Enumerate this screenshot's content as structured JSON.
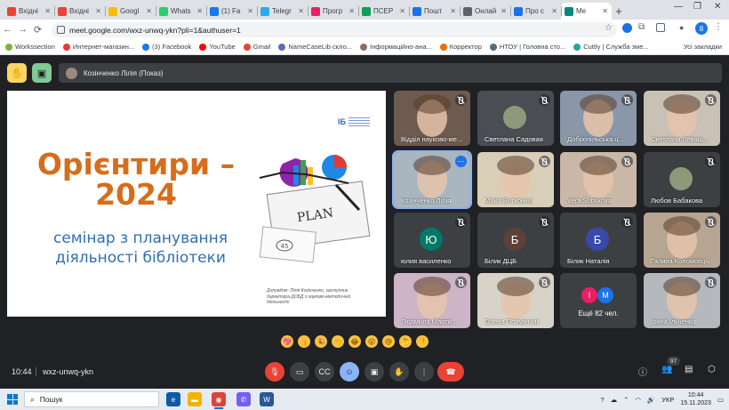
{
  "browser": {
    "tabs": [
      {
        "label": "Вхідні",
        "color": "#ea4335"
      },
      {
        "label": "Вхідні",
        "color": "#ea4335"
      },
      {
        "label": "Googl",
        "color": "#fbbc04"
      },
      {
        "label": "Whats",
        "color": "#25d366"
      },
      {
        "label": "(1) Fa",
        "color": "#1877f2"
      },
      {
        "label": "Telegr",
        "color": "#2aabee"
      },
      {
        "label": "Прогр",
        "color": "#e91e63"
      },
      {
        "label": "ПСЕР",
        "color": "#0f9d58"
      },
      {
        "label": "Пошт",
        "color": "#1a73e8"
      },
      {
        "label": "Онлай",
        "color": "#5f6368"
      },
      {
        "label": "Про с",
        "color": "#1a73e8"
      },
      {
        "label": "Me",
        "color": "#00897b",
        "active": true
      }
    ],
    "url": "meet.google.com/wxz-unwq-ykn?pli=1&authuser=1",
    "bookmarks": [
      {
        "label": "Workssection",
        "color": "#7cb342"
      },
      {
        "label": "Интернет-магазин...",
        "color": "#e53935"
      },
      {
        "label": "(3) Facebook",
        "color": "#1877f2"
      },
      {
        "label": "YouTube",
        "color": "#ff0000"
      },
      {
        "label": "Gmail",
        "color": "#ea4335"
      },
      {
        "label": "NameCaseLib скло...",
        "color": "#5c6bc0"
      },
      {
        "label": "Інформаційно-ана...",
        "color": "#8d6e63"
      },
      {
        "label": "Корректор",
        "color": "#ef6c00"
      },
      {
        "label": "НТОУ | Головна сто...",
        "color": "#546e7a"
      },
      {
        "label": "Cuttly | Служба зме...",
        "color": "#26a69a"
      }
    ],
    "all_bookmarks": "Усі закладки"
  },
  "meet": {
    "presenter_label": "Козінченко Лілія (Показ)",
    "slide": {
      "title_line1": "Орієнтири –",
      "title_line2": "2024",
      "subtitle_line1": "семінар з планування",
      "subtitle_line2": "діяльності бібліотеки",
      "footer": "Доповідач: Лілія Козінченко, заступник директора ДОБД з науково-методичної діяльності",
      "plan_label": "PLAN"
    },
    "participants": [
      {
        "name": "Відділ науково-ме...",
        "bg": "#6d5b4f",
        "type": "video"
      },
      {
        "name": "Светлана Садовая",
        "bg": "#4a4d52",
        "type": "photo"
      },
      {
        "name": "Добропільська ц...",
        "bg": "#8a97a8",
        "type": "video"
      },
      {
        "name": "Светлана Леваш...",
        "bg": "#c9c1b5",
        "type": "video"
      },
      {
        "name": "Козінченко Лілія",
        "bg": "#a9b5bf",
        "type": "video",
        "selected": true
      },
      {
        "name": "Майя Витконіна",
        "bg": "#d9cfb8",
        "type": "video"
      },
      {
        "name": "Vera Soblikova",
        "bg": "#c9b8a8",
        "type": "video"
      },
      {
        "name": "Любов Бабакова",
        "bg": "#3c4043",
        "type": "photo"
      },
      {
        "name": "юлия василенко",
        "bg": "#3c4043",
        "type": "avatar",
        "letter": "Ю",
        "avatar_color": "#00796b"
      },
      {
        "name": "Білик ДЦБ",
        "bg": "#3c4043",
        "type": "avatar",
        "letter": "Б",
        "avatar_color": "#5d4037"
      },
      {
        "name": "Білик Наталія",
        "bg": "#3c4043",
        "type": "avatar",
        "letter": "Б",
        "avatar_color": "#3949ab"
      },
      {
        "name": "Галина Коломоєць",
        "bg": "#b7a593",
        "type": "video"
      },
      {
        "name": "Людмила Марти...",
        "bg": "#cdb4c6",
        "type": "video"
      },
      {
        "name": "Олена Полуянчик",
        "bg": "#d8d3c8",
        "type": "video"
      },
      {
        "name": "Ещё 82 чел.",
        "bg": "#3c4043",
        "type": "more",
        "letters": [
          "І",
          "М"
        ]
      },
      {
        "name": "Ірина Ільченко",
        "bg": "#b5b9be",
        "type": "video"
      }
    ],
    "reactions": [
      "💖",
      "👍",
      "🎉",
      "👏",
      "😂",
      "😮",
      "😢",
      "🤔",
      "👎"
    ],
    "time": "10:44",
    "meeting_code": "wxz-unwq-ykn",
    "people_count": "97"
  },
  "taskbar": {
    "search_placeholder": "Пошук",
    "lang": "УКР",
    "time": "10:44",
    "date": "15.11.2023"
  }
}
